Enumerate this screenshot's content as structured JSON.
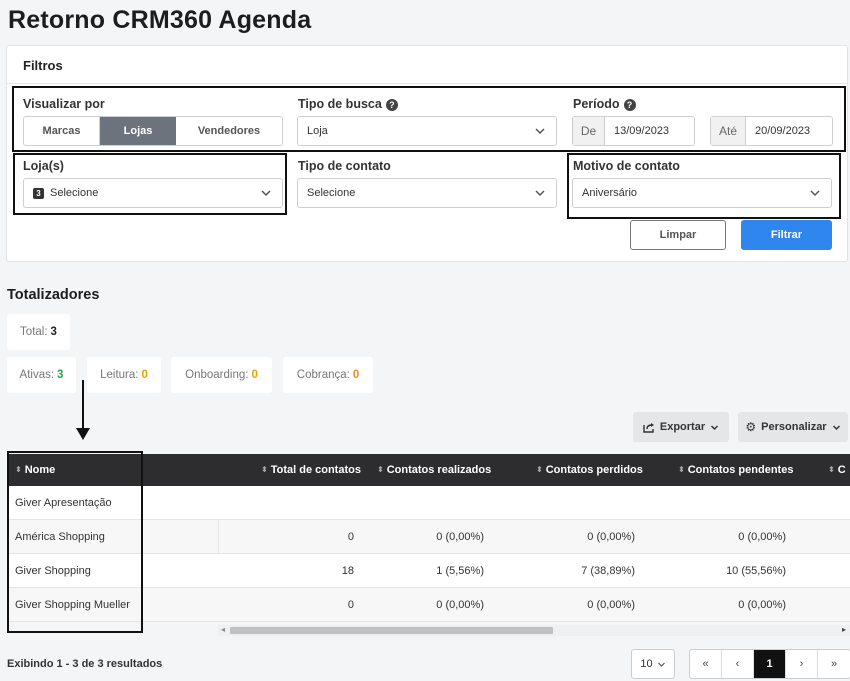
{
  "page": {
    "title": "Retorno CRM360 Agenda"
  },
  "filters": {
    "header": "Filtros",
    "view_by": {
      "label": "Visualizar por",
      "options": [
        "Marcas",
        "Lojas",
        "Vendedores"
      ],
      "selected": "Lojas"
    },
    "search_type": {
      "label": "Tipo de busca",
      "value": "Loja"
    },
    "period": {
      "label": "Período",
      "from_prefix": "De",
      "from_value": "13/09/2023",
      "to_prefix": "Até",
      "to_value": "20/09/2023"
    },
    "stores": {
      "label": "Loja(s)",
      "count": "3",
      "value": "Selecione"
    },
    "contact_type": {
      "label": "Tipo de contato",
      "value": "Selecione"
    },
    "contact_reason": {
      "label": "Motivo de contato",
      "value": "Aniversário"
    },
    "clear_label": "Limpar",
    "filter_label": "Filtrar"
  },
  "totals": {
    "title": "Totalizadores",
    "total": {
      "label": "Total:",
      "value": "3"
    },
    "active": {
      "label": "Ativas:",
      "value": "3"
    },
    "reading": {
      "label": "Leitura:",
      "value": "0"
    },
    "onboarding": {
      "label": "Onboarding:",
      "value": "0"
    },
    "billing": {
      "label": "Cobrança:",
      "value": "0"
    }
  },
  "toolbar": {
    "export_label": "Exportar",
    "customize_label": "Personalizar"
  },
  "table": {
    "columns": [
      "Nome",
      "Total de contatos",
      "Contatos realizados",
      "Contatos perdidos",
      "Contatos pendentes",
      "C"
    ],
    "rows": [
      {
        "name": "Giver Apresentação",
        "total": "",
        "done": "",
        "lost": "",
        "pending": ""
      },
      {
        "name": "América Shopping",
        "total": "0",
        "done": "0 (0,00%)",
        "lost": "0 (0,00%)",
        "pending": "0 (0,00%)"
      },
      {
        "name": "Giver Shopping",
        "total": "18",
        "done": "1 (5,56%)",
        "lost": "7 (38,89%)",
        "pending": "10 (55,56%)"
      },
      {
        "name": "Giver Shopping Mueller",
        "total": "0",
        "done": "0 (0,00%)",
        "lost": "0 (0,00%)",
        "pending": "0 (0,00%)"
      }
    ]
  },
  "footer": {
    "summary": "Exibindo 1 - 3 de 3 resultados",
    "page_size": "10",
    "current_page": "1",
    "first": "«",
    "prev": "‹",
    "next": "›",
    "last": "»"
  }
}
